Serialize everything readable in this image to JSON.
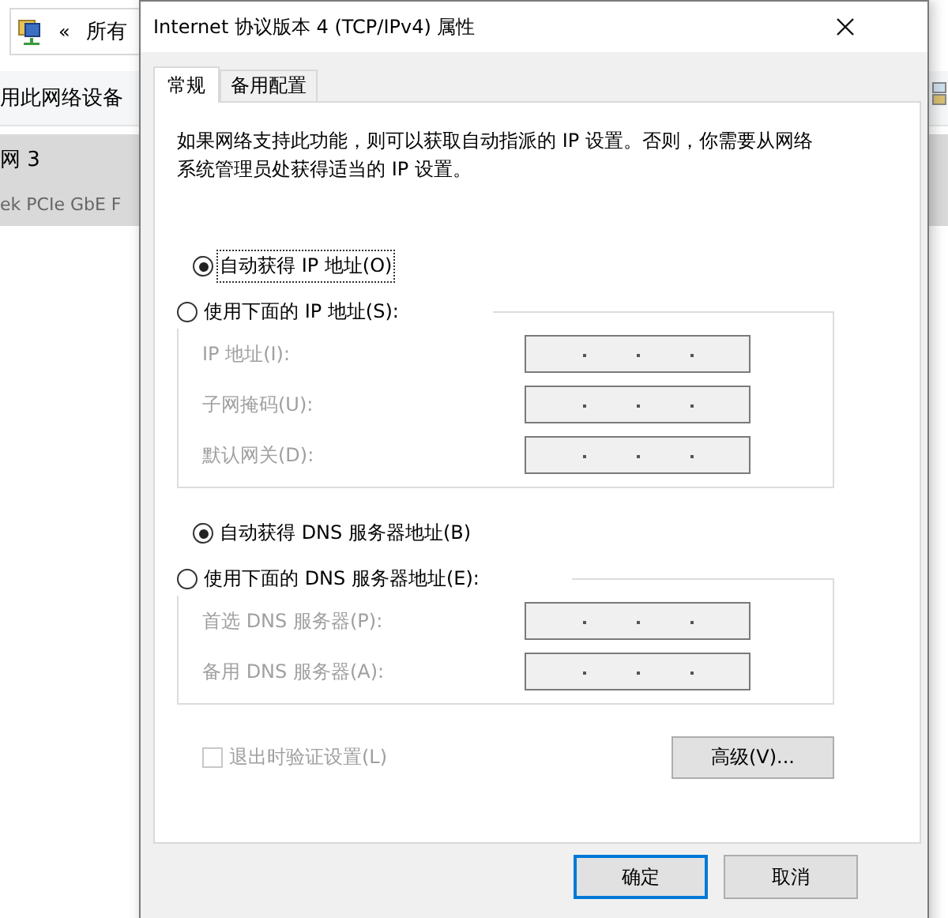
{
  "background_window": {
    "address_bar": {
      "back_mark": "«",
      "path": "所有"
    },
    "toolbar": {
      "label": "用此网络设备"
    },
    "selected_item": {
      "name": "网 3",
      "subtitle": "ek PCIe GbE F"
    }
  },
  "dialog": {
    "title": "Internet 协议版本 4 (TCP/IPv4) 属性",
    "tabs": [
      {
        "label": "常规",
        "selected": true
      },
      {
        "label": "备用配置",
        "selected": false
      }
    ],
    "description": "如果网络支持此功能，则可以获取自动指派的 IP 设置。否则，你需要从网络系统管理员处获得适当的 IP 设置。",
    "ip_section": {
      "auto_option": {
        "label": "自动获得 IP 地址(O)",
        "selected": true,
        "focused": true
      },
      "manual_option": {
        "label": "使用下面的 IP 地址(S):",
        "selected": false
      },
      "disabled": true,
      "fields": [
        {
          "label": "IP 地址(I):"
        },
        {
          "label": "子网掩码(U):"
        },
        {
          "label": "默认网关(D):"
        }
      ]
    },
    "dns_section": {
      "auto_option": {
        "label": "自动获得 DNS 服务器地址(B)",
        "selected": true,
        "focused": false
      },
      "manual_option": {
        "label": "使用下面的 DNS 服务器地址(E):",
        "selected": false
      },
      "disabled": true,
      "fields": [
        {
          "label": "首选 DNS 服务器(P):"
        },
        {
          "label": "备用 DNS 服务器(A):"
        }
      ]
    },
    "validate_checkbox": {
      "label": "退出时验证设置(L)",
      "checked": false,
      "disabled": true
    },
    "advanced_button": "高级(V)...",
    "ok_button": {
      "label": "确定",
      "default": true
    },
    "cancel_button": {
      "label": "取消",
      "default": false
    }
  }
}
